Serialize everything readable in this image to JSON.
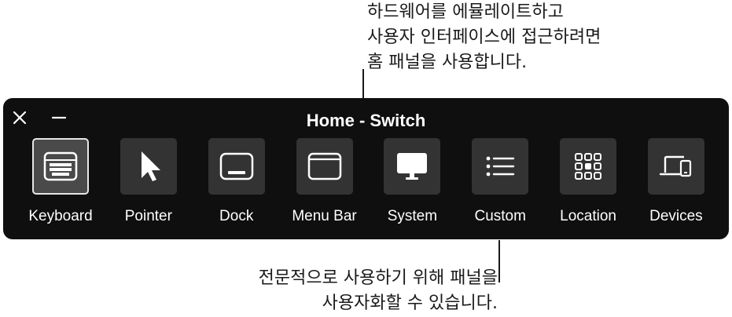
{
  "callouts": {
    "top": [
      "하드웨어를 에뮬레이트하고",
      "사용자 인터페이스에 접근하려면",
      "홈 패널을 사용합니다."
    ],
    "bottom": [
      "전문적으로 사용하기 위해 패널을",
      "사용자화할 수 있습니다."
    ]
  },
  "panel": {
    "title": "Home - Switch",
    "close_icon": "close-icon",
    "minimize_icon": "minimize-icon",
    "items": [
      {
        "label": "Keyboard",
        "icon": "keyboard-icon",
        "selected": true
      },
      {
        "label": "Pointer",
        "icon": "pointer-icon",
        "selected": false
      },
      {
        "label": "Dock",
        "icon": "dock-icon",
        "selected": false
      },
      {
        "label": "Menu Bar",
        "icon": "menu-bar-icon",
        "selected": false
      },
      {
        "label": "System",
        "icon": "system-icon",
        "selected": false
      },
      {
        "label": "Custom",
        "icon": "custom-icon",
        "selected": false
      },
      {
        "label": "Location",
        "icon": "location-icon",
        "selected": false
      },
      {
        "label": "Devices",
        "icon": "devices-icon",
        "selected": false
      }
    ]
  },
  "colors": {
    "panel_background": "#0f0f0f",
    "tile_background": "#333333",
    "selected_tile_background": "#4a4a4a",
    "selected_tile_border": "#e6e6e6",
    "text": "#ffffff"
  }
}
